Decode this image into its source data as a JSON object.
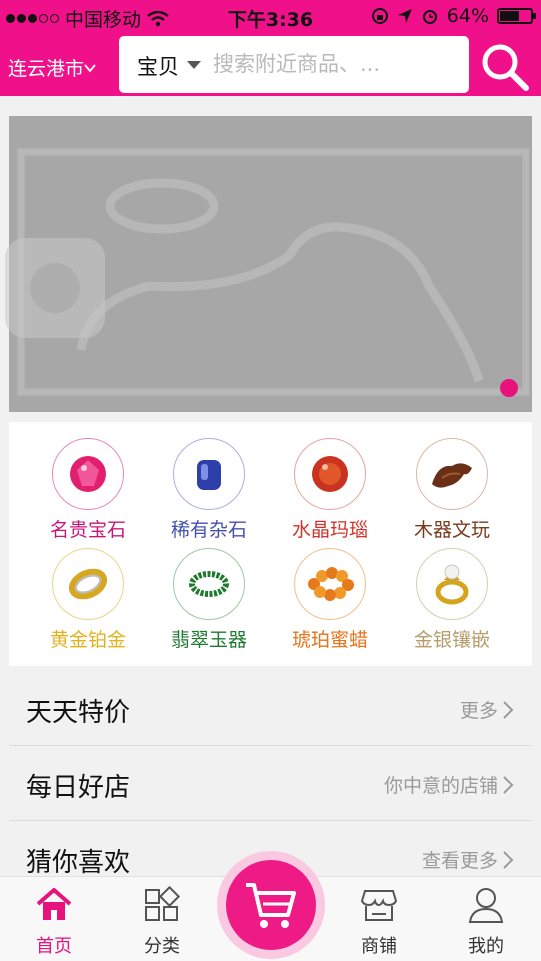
{
  "status_bar": {
    "carrier": "中国移动",
    "time": "下午3:36",
    "battery": "64%",
    "battery_level": 0.64,
    "signal_bars": 3
  },
  "header": {
    "city": "连云港市",
    "search_type": "宝贝",
    "search_placeholder": "搜索附近商品、..."
  },
  "banner": {
    "image": "placeholder-image-icon",
    "pager_color": "#e8127c"
  },
  "categories": [
    {
      "label": "名贵宝石",
      "color": "#c8177a",
      "icon": "ruby-gem-icon"
    },
    {
      "label": "稀有杂石",
      "color": "#4450b0",
      "icon": "blue-stone-icon"
    },
    {
      "label": "水晶玛瑙",
      "color": "#d2332a",
      "icon": "agate-bead-icon"
    },
    {
      "label": "木器文玩",
      "color": "#7a3a1c",
      "icon": "wood-carving-icon"
    },
    {
      "label": "黄金铂金",
      "color": "#e2b31f",
      "icon": "gold-ring-icon"
    },
    {
      "label": "翡翠玉器",
      "color": "#1f7a32",
      "icon": "jade-bracelet-icon"
    },
    {
      "label": "琥珀蜜蜡",
      "color": "#e8731a",
      "icon": "amber-bracelet-icon"
    },
    {
      "label": "金银镶嵌",
      "color": "#b69d6a",
      "icon": "pearl-ring-icon"
    }
  ],
  "sections": [
    {
      "title": "天天特价",
      "more": "更多"
    },
    {
      "title": "每日好店",
      "more": "你中意的店铺"
    },
    {
      "title": "猜你喜欢",
      "more": "查看更多"
    }
  ],
  "tabbar": {
    "tabs": [
      {
        "label": "首页",
        "icon": "home-icon",
        "active": true
      },
      {
        "label": "分类",
        "icon": "category-icon",
        "active": false
      },
      {
        "label": "商铺",
        "icon": "shop-icon",
        "active": false
      },
      {
        "label": "我的",
        "icon": "profile-icon",
        "active": false
      }
    ],
    "center_icon": "cart-icon"
  },
  "colors": {
    "brand": "#f0108a",
    "accent": "#e8127c"
  }
}
